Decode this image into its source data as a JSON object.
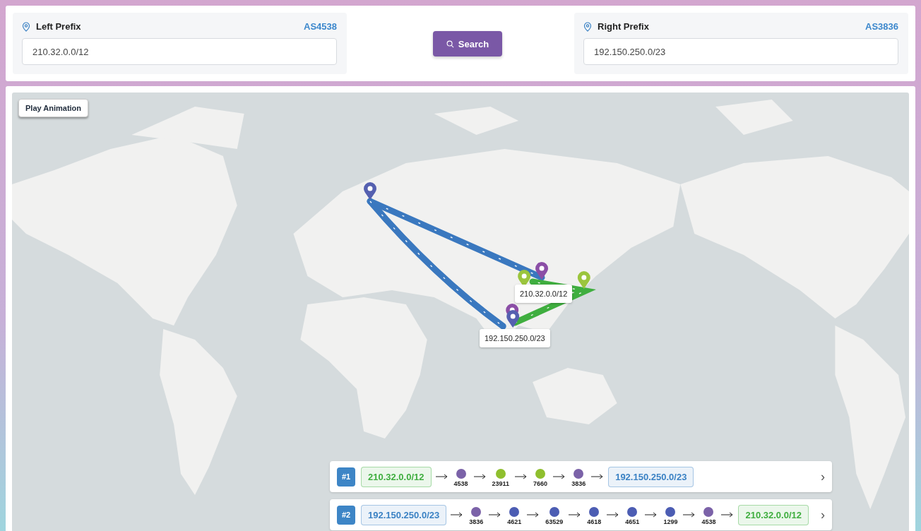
{
  "search_bar": {
    "left": {
      "label": "Left Prefix",
      "asn": "AS4538",
      "value": "210.32.0.0/12"
    },
    "button": "Search",
    "right": {
      "label": "Right Prefix",
      "asn": "AS3836",
      "value": "192.150.250.0/23"
    }
  },
  "map": {
    "play_button": "Play Animation",
    "tooltips": [
      "210.32.0.0/12",
      "192.150.250.0/23"
    ]
  },
  "paths": [
    {
      "rank": "#1",
      "source": {
        "prefix": "210.32.0.0/12",
        "color": "#3fae3f"
      },
      "hops": [
        {
          "asn": "4538",
          "color": "#7b62a8"
        },
        {
          "asn": "23911",
          "color": "#8fbf2e"
        },
        {
          "asn": "7660",
          "color": "#8fbf2e"
        },
        {
          "asn": "3836",
          "color": "#7b62a8"
        }
      ],
      "destination": {
        "prefix": "192.150.250.0/23",
        "color": "#3b82c4"
      },
      "chevron": "›"
    },
    {
      "rank": "#2",
      "source": {
        "prefix": "192.150.250.0/23",
        "color": "#3b82c4"
      },
      "hops": [
        {
          "asn": "3836",
          "color": "#7b62a8"
        },
        {
          "asn": "4621",
          "color": "#4c5db3"
        },
        {
          "asn": "63529",
          "color": "#4c5db3"
        },
        {
          "asn": "4618",
          "color": "#4c5db3"
        },
        {
          "asn": "4651",
          "color": "#4c5db3"
        },
        {
          "asn": "1299",
          "color": "#4c5db3"
        },
        {
          "asn": "4538",
          "color": "#7b62a8"
        }
      ],
      "destination": {
        "prefix": "210.32.0.0/12",
        "color": "#3fae3f"
      },
      "chevron": "›"
    }
  ]
}
